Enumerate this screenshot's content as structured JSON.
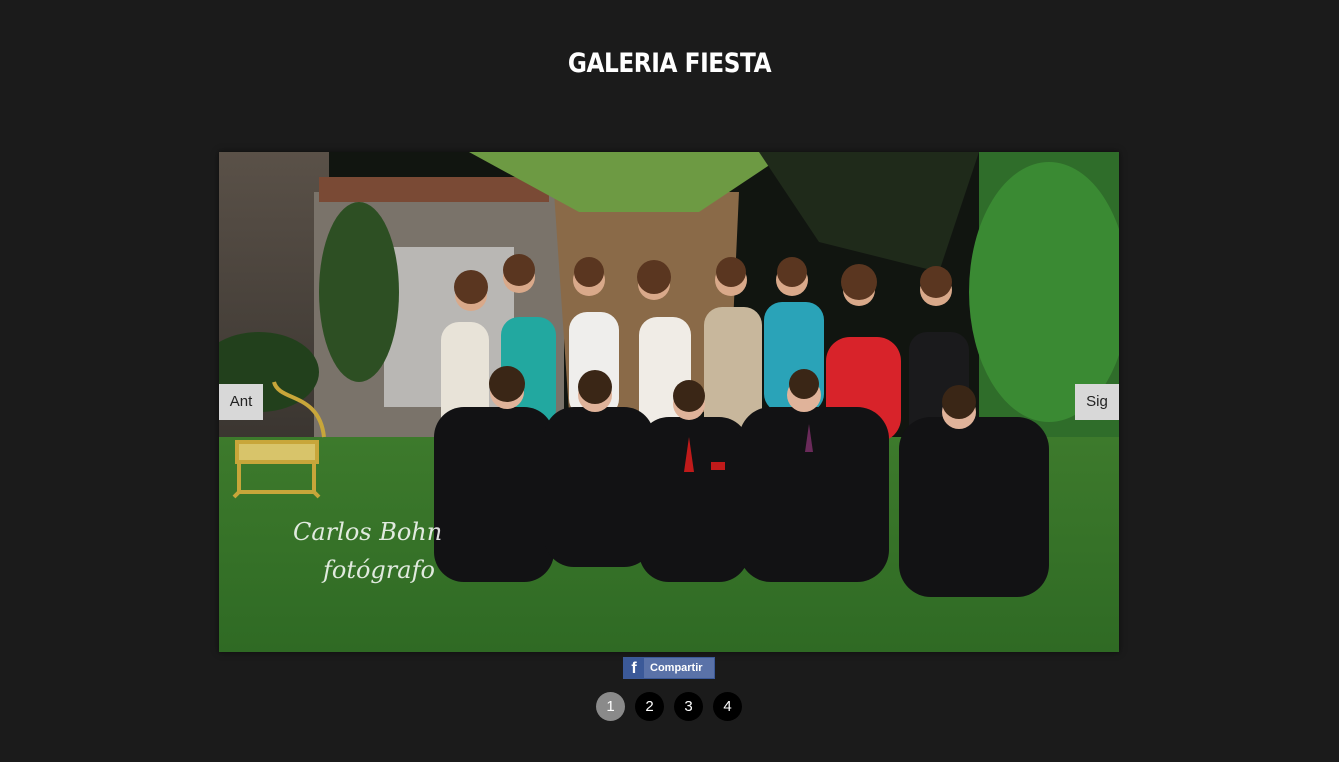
{
  "gallery": {
    "title": "GALERIA FIESTA",
    "prev_label": "Ant",
    "next_label": "Sig",
    "watermark_line1": "Carlos Bohn",
    "watermark_line2": "fotógrafo"
  },
  "share": {
    "label": "Compartir",
    "icon": "facebook-icon"
  },
  "pager": {
    "pages": [
      "1",
      "2",
      "3",
      "4"
    ],
    "active": "1"
  },
  "colors": {
    "background": "#1b1b1b",
    "active_dot": "#8a8a8a",
    "dot": "#000000",
    "facebook": "#3b5998"
  }
}
